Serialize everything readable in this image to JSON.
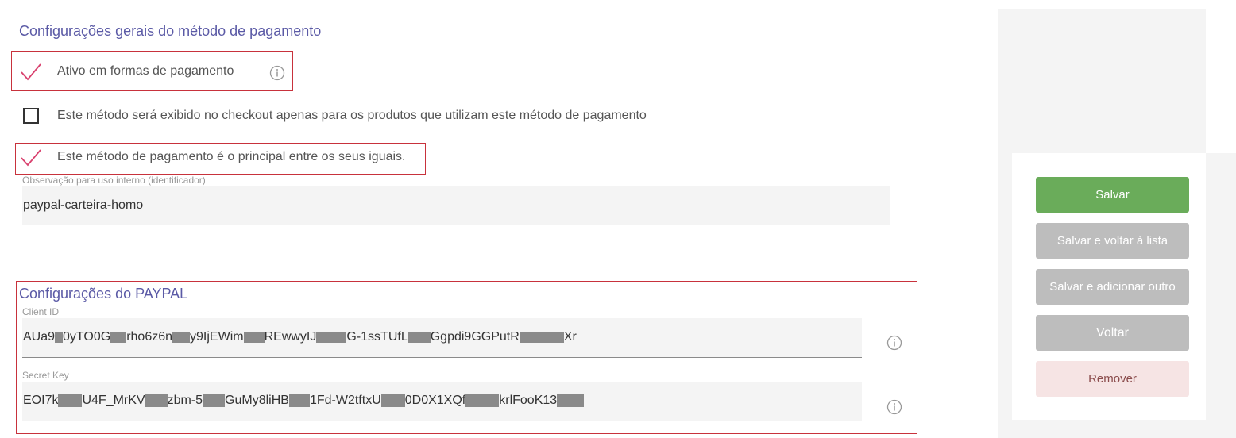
{
  "general": {
    "title": "Configurações gerais do método de pagamento",
    "active_label": "Ativo em formas de pagamento",
    "checkout_only_label": "Este método será exibido no checkout apenas para os produtos que utilizam este método de pagamento",
    "principal_label": "Este método de pagamento é o principal entre os seus iguais.",
    "active_checked": true,
    "checkout_only_checked": false,
    "principal_checked": true,
    "note_caption": "Observação para uso interno (identificador)",
    "note_value": "paypal-carteira-homo"
  },
  "paypal": {
    "title": "Configurações do PAYPAL",
    "client_id_caption": "Client ID",
    "client_id_parts": [
      "AUa9",
      "0yTO0G",
      "rho6z6n",
      "y9IjEWim",
      "REwwyIJ",
      "G-1ssTUfL",
      "Ggpdi9GGPutR",
      "Xr"
    ],
    "secret_key_caption": "Secret Key",
    "secret_key_parts": [
      "EOI7k",
      "U4F_MrKV",
      "zbm-5",
      "GuMy8liHB",
      "1Fd-W2tftxU",
      "0D0X1XQf",
      "krlFooK13"
    ]
  },
  "actions": {
    "save": "Salvar",
    "save_back": "Salvar e voltar à lista",
    "save_add": "Salvar e adicionar outro",
    "back": "Voltar",
    "remove": "Remover"
  },
  "colors": {
    "accent_title": "#5b5aa6",
    "check_mark": "#d9416e",
    "highlight_box": "#c8323c",
    "save_button": "#6aac5a",
    "secondary_button": "#bdbdbd",
    "remove_button_bg": "#f6e4e4",
    "remove_button_text": "#8a4b4b"
  },
  "icons": {
    "check": "check-icon",
    "info": "info-icon"
  }
}
